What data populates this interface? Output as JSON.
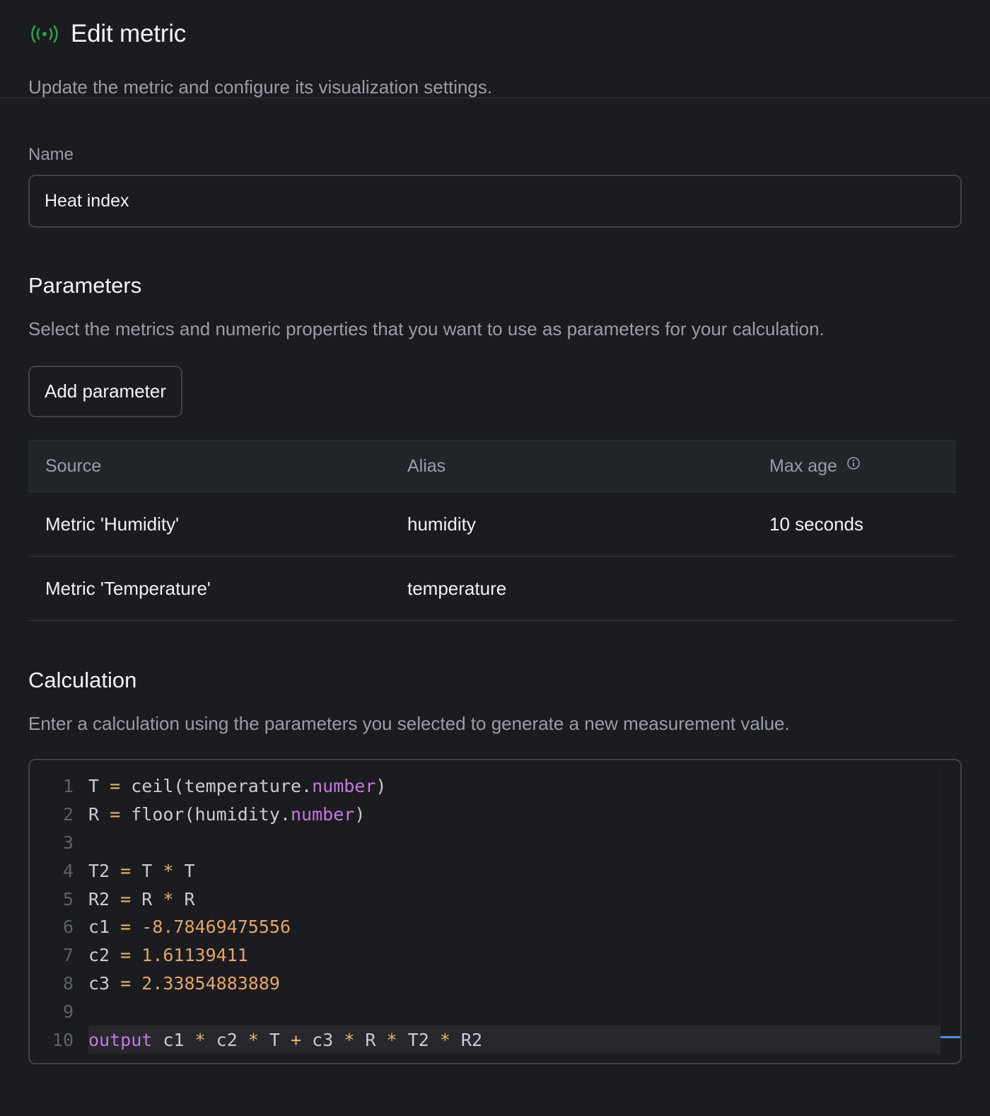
{
  "header": {
    "title": "Edit metric",
    "subtitle": "Update the metric and configure its visualization settings.",
    "icon": "signal-icon",
    "accent_color": "#2ea043"
  },
  "name_field": {
    "label": "Name",
    "value": "Heat index"
  },
  "parameters": {
    "title": "Parameters",
    "description": "Select the metrics and numeric properties that you want to use as parameters for your calculation.",
    "add_button_label": "Add parameter",
    "columns": [
      "Source",
      "Alias",
      "Max age"
    ],
    "rows": [
      {
        "source": "Metric 'Humidity'",
        "alias": "humidity",
        "max_age": "10 seconds"
      },
      {
        "source": "Metric 'Temperature'",
        "alias": "temperature",
        "max_age": ""
      }
    ]
  },
  "calculation": {
    "title": "Calculation",
    "description": "Enter a calculation using the parameters you selected to generate a new measurement value.",
    "code_lines": [
      {
        "n": "1",
        "tokens": [
          {
            "t": "T ",
            "c": ""
          },
          {
            "t": "=",
            "c": "op"
          },
          {
            "t": " ceil(temperature.",
            "c": ""
          },
          {
            "t": "number",
            "c": "prop"
          },
          {
            "t": ")",
            "c": ""
          }
        ]
      },
      {
        "n": "2",
        "tokens": [
          {
            "t": "R ",
            "c": ""
          },
          {
            "t": "=",
            "c": "op"
          },
          {
            "t": " floor(humidity.",
            "c": ""
          },
          {
            "t": "number",
            "c": "prop"
          },
          {
            "t": ")",
            "c": ""
          }
        ]
      },
      {
        "n": "3",
        "tokens": []
      },
      {
        "n": "4",
        "tokens": [
          {
            "t": "T2 ",
            "c": ""
          },
          {
            "t": "=",
            "c": "op"
          },
          {
            "t": " T ",
            "c": ""
          },
          {
            "t": "*",
            "c": "op"
          },
          {
            "t": " T",
            "c": ""
          }
        ]
      },
      {
        "n": "5",
        "tokens": [
          {
            "t": "R2 ",
            "c": ""
          },
          {
            "t": "=",
            "c": "op"
          },
          {
            "t": " R ",
            "c": ""
          },
          {
            "t": "*",
            "c": "op"
          },
          {
            "t": " R",
            "c": ""
          }
        ]
      },
      {
        "n": "6",
        "tokens": [
          {
            "t": "c1 ",
            "c": ""
          },
          {
            "t": "=",
            "c": "op"
          },
          {
            "t": " ",
            "c": ""
          },
          {
            "t": "-8.78469475556",
            "c": "num"
          }
        ]
      },
      {
        "n": "7",
        "tokens": [
          {
            "t": "c2 ",
            "c": ""
          },
          {
            "t": "=",
            "c": "op"
          },
          {
            "t": " ",
            "c": ""
          },
          {
            "t": "1.61139411",
            "c": "num"
          }
        ]
      },
      {
        "n": "8",
        "tokens": [
          {
            "t": "c3 ",
            "c": ""
          },
          {
            "t": "=",
            "c": "op"
          },
          {
            "t": " ",
            "c": ""
          },
          {
            "t": "2.33854883889",
            "c": "num"
          }
        ]
      },
      {
        "n": "9",
        "tokens": []
      },
      {
        "n": "10",
        "active": true,
        "tokens": [
          {
            "t": "output",
            "c": "kw"
          },
          {
            "t": " c1 ",
            "c": ""
          },
          {
            "t": "*",
            "c": "op"
          },
          {
            "t": " c2 ",
            "c": ""
          },
          {
            "t": "*",
            "c": "op"
          },
          {
            "t": " T ",
            "c": ""
          },
          {
            "t": "+",
            "c": "op"
          },
          {
            "t": " c3 ",
            "c": ""
          },
          {
            "t": "*",
            "c": "op"
          },
          {
            "t": " R ",
            "c": ""
          },
          {
            "t": "*",
            "c": "op"
          },
          {
            "t": " T2 ",
            "c": ""
          },
          {
            "t": "*",
            "c": "op"
          },
          {
            "t": " R2",
            "c": ""
          }
        ]
      }
    ]
  }
}
